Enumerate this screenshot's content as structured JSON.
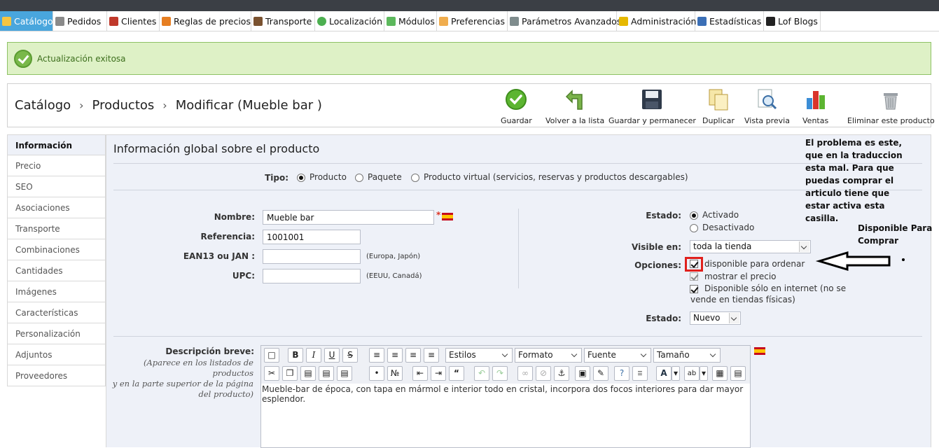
{
  "nav": {
    "tabs": [
      {
        "label": "Catálogo",
        "icon": "folder-icon",
        "color": "#f4c542"
      },
      {
        "label": "Pedidos",
        "icon": "cart-icon",
        "color": "#8a8a8a"
      },
      {
        "label": "Clientes",
        "icon": "user-icon",
        "color": "#c0392b"
      },
      {
        "label": "Reglas de precios",
        "icon": "price-tag-icon",
        "color": "#e67e22"
      },
      {
        "label": "Transporte",
        "icon": "truck-icon",
        "color": "#7a5230"
      },
      {
        "label": "Localización",
        "icon": "globe-icon",
        "color": "#4caf50"
      },
      {
        "label": "Módulos",
        "icon": "puzzle-icon",
        "color": "#5cb85c"
      },
      {
        "label": "Preferencias",
        "icon": "edit-icon",
        "color": "#f0ad4e"
      },
      {
        "label": "Parámetros Avanzados",
        "icon": "wrench-icon",
        "color": "#7f8c8d"
      },
      {
        "label": "Administración",
        "icon": "key-icon",
        "color": "#e6b800"
      },
      {
        "label": "Estadísticas",
        "icon": "stats-icon",
        "color": "#3b6fb6"
      },
      {
        "label": "Lof Blogs",
        "icon": "lock-icon",
        "color": "#222222"
      }
    ]
  },
  "alert": {
    "message": "Actualización exitosa"
  },
  "breadcrumb": {
    "root": "Catálogo",
    "section": "Productos",
    "current": "Modificar (Mueble bar )"
  },
  "toolbar": {
    "save": "Guardar",
    "back": "Volver a la lista",
    "save_stay": "Guardar y permanecer",
    "duplicate": "Duplicar",
    "preview": "Vista previa",
    "sales": "Ventas",
    "delete": "Eliminar este producto"
  },
  "sidebar": {
    "items": [
      "Información",
      "Precio",
      "SEO",
      "Asociaciones",
      "Transporte",
      "Combinaciones",
      "Cantidades",
      "Imágenes",
      "Características",
      "Personalización",
      "Adjuntos",
      "Proveedores"
    ]
  },
  "form": {
    "title": "Información global sobre el producto",
    "type_label": "Tipo:",
    "type_options": [
      "Producto",
      "Paquete",
      "Producto virtual (servicios, reservas y productos descargables)"
    ],
    "name_label": "Nombre:",
    "name_value": "Mueble bar",
    "required_mark": "*",
    "reference_label": "Referencia:",
    "reference_value": "1001001",
    "ean_label": "EAN13 ou JAN :",
    "ean_value": "",
    "ean_hint": "(Europa, Japón)",
    "upc_label": "UPC:",
    "upc_value": "",
    "upc_hint": "(EEUU, Canadá)",
    "status_label": "Estado:",
    "status_on": "Activado",
    "status_off": "Desactivado",
    "visible_label": "Visible en:",
    "visible_value": "toda la tienda",
    "options_label": "Opciones:",
    "opt_available": "disponible para ordenar",
    "opt_show_price": "mostrar el precio",
    "opt_online_1": "Disponible sólo en internet (no se",
    "opt_online_2": "vende en tiendas físicas)",
    "condition_label": "Estado:",
    "condition_value": "Nuevo",
    "short_desc_label": "Descripción breve:",
    "short_desc_hint_1": "(Aparece en los listados de productos",
    "short_desc_hint_2": "y en la parte superior de la página",
    "short_desc_hint_3": "del producto)",
    "short_desc_value": "Mueble-bar de época, con tapa en mármol e interior todo en cristal, incorpora dos focos interiores para dar mayor esplendor."
  },
  "editor": {
    "styles": "Estilos",
    "format": "Formato",
    "font": "Fuente",
    "size": "Tamaño"
  },
  "annotation": {
    "lines": [
      "El problema es este,",
      "que en la traduccion",
      "esta mal. Para que",
      "puedas comprar el",
      "articulo tiene que",
      "estar activa esta",
      "casilla."
    ],
    "label_1": "Disponible Para",
    "label_2": "Comprar"
  }
}
